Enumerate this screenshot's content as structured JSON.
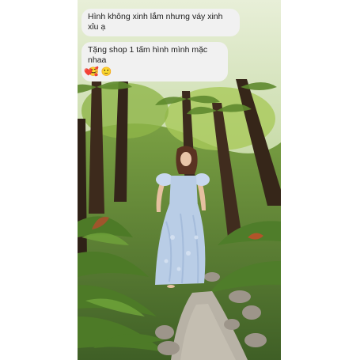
{
  "chat": {
    "messages": [
      {
        "text": "Hình không xinh lắm nhưng váy xinh xỉu ạ"
      },
      {
        "text": "Tặng shop 1 tấm hình mình mặc nhaa",
        "emojis": "🥰 🙂"
      }
    ],
    "reaction": "❤️"
  },
  "photo": {
    "subject_icon": "woman-in-blue-dress",
    "colors": {
      "foliage": "#6f9a3a",
      "trunk": "#3d2a1c",
      "dress": "#b9cde6",
      "path": "#b8b2a6"
    }
  }
}
